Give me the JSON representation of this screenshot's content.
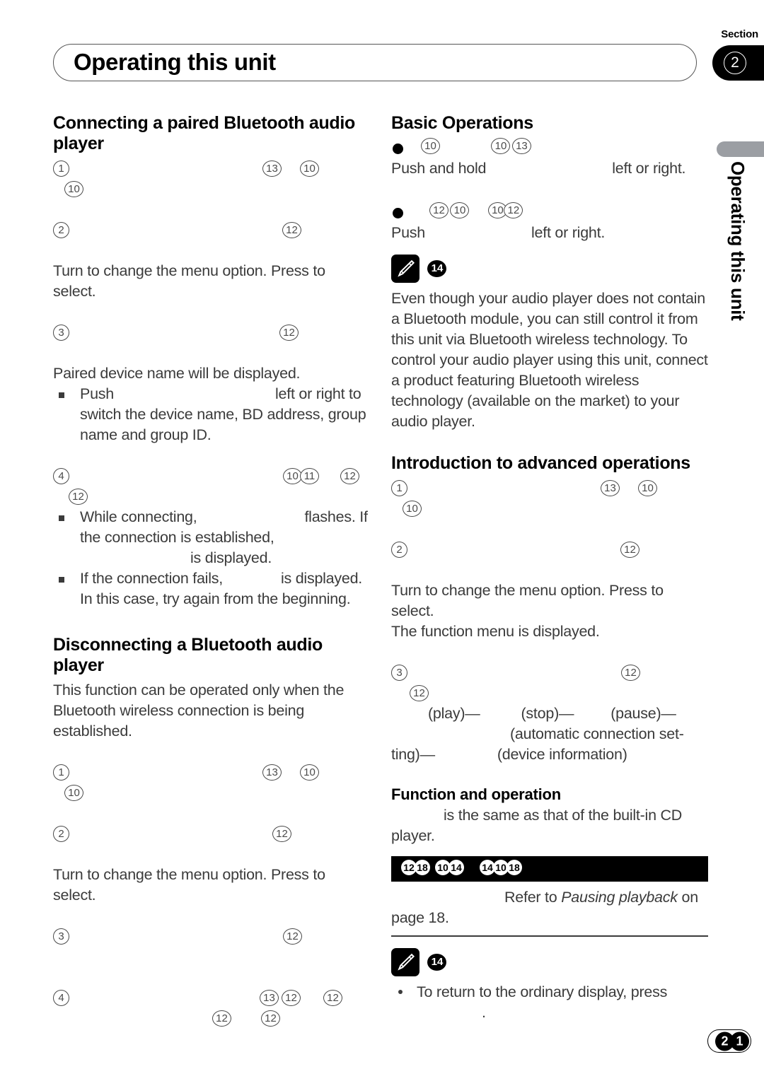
{
  "header": {
    "title": "Operating this unit",
    "section_label": "Section",
    "section_number": "2",
    "side_tab_text": "Operating this unit"
  },
  "footer": {
    "page_digits": [
      "2",
      "1"
    ]
  },
  "left_column": {
    "heading_1": "Connecting a paired Bluetooth audio player",
    "steps_1": [
      {
        "index": "1",
        "markers": [
          "13",
          "10"
        ],
        "markers_second_line": [
          "10"
        ]
      },
      {
        "index": "2",
        "markers": [
          "12"
        ],
        "body": "Turn to change the menu option. Press to select."
      },
      {
        "index": "3",
        "markers": [
          "12"
        ],
        "body": "Paired device name will be displayed."
      }
    ],
    "bullets_1": [
      {
        "pre": "Push",
        "post": "left or right to switch the device name, BD address, group name and group ID."
      }
    ],
    "step_4": {
      "index": "4",
      "markers": [
        "10",
        "11",
        "12"
      ],
      "markers_second_line": [
        "12"
      ]
    },
    "bullets_2": [
      {
        "pre": "While connecting,",
        "mid": "flashes. If the connection is established,",
        "post": "is displayed."
      },
      {
        "pre": "If the connection fails,",
        "post": "is displayed. In this case, try again from the beginning."
      }
    ],
    "heading_2": "Disconnecting a Bluetooth audio player",
    "intro_2": "This function can be operated only when the Bluetooth wireless connection is being established.",
    "steps_2": [
      {
        "index": "1",
        "markers": [
          "13",
          "10"
        ],
        "markers_second_line": [
          "10"
        ]
      },
      {
        "index": "2",
        "markers": [
          "12"
        ],
        "body": "Turn to change the menu option. Press to select."
      },
      {
        "index": "3",
        "markers": [
          "12"
        ]
      },
      {
        "index": "4",
        "markers": [
          "13",
          "12",
          "12"
        ],
        "markers_second_line": [
          "12",
          "12"
        ]
      }
    ]
  },
  "right_column": {
    "heading_basic": "Basic Operations",
    "basic_bullets": [
      {
        "markers": [
          "10",
          "10",
          "13"
        ],
        "text_pre": "Push and hold",
        "text_post": "left or right."
      },
      {
        "markers": [
          "12",
          "10",
          "10",
          "12"
        ],
        "text_pre": "Push",
        "text_post": "left or right."
      }
    ],
    "note_1": {
      "badge": "14",
      "text": "Even though your audio player does not contain a Bluetooth module, you can still control it from this unit via Bluetooth wireless technology. To control your audio player using this unit, connect a product featuring Bluetooth wireless technology (available on the market) to your audio player."
    },
    "heading_intro": "Introduction to advanced operations",
    "intro_steps": [
      {
        "index": "1",
        "markers": [
          "13",
          "10"
        ],
        "markers_second_line": [
          "10"
        ]
      },
      {
        "index": "2",
        "markers": [
          "12"
        ],
        "body_1": "Turn to change the menu option. Press to select.",
        "body_2": "The function menu is displayed."
      },
      {
        "index": "3",
        "markers": [
          "12"
        ],
        "markers_second_line": [
          "12"
        ]
      }
    ],
    "menu_items_line_1": "(play)—",
    "menu_items_line_1b": "(stop)—",
    "menu_items_line_1c": "(pause)—",
    "menu_items_line_2": "(automatic connection set-",
    "menu_items_line_3a": "ting)—",
    "menu_items_line_3b": "(device information)",
    "heading_function": "Function and operation",
    "function_text_post": "is the same as that of the built-in CD player.",
    "black_bar_markers_group_1": [
      "12",
      "18",
      "10",
      "14"
    ],
    "black_bar_markers_group_2": [
      "14",
      "10",
      "18"
    ],
    "refer_prefix": "Refer to",
    "refer_italic": "Pausing playback",
    "refer_suffix": "on page 18.",
    "note_2": {
      "badge": "14",
      "bullet": "To return to the ordinary display, press"
    }
  }
}
